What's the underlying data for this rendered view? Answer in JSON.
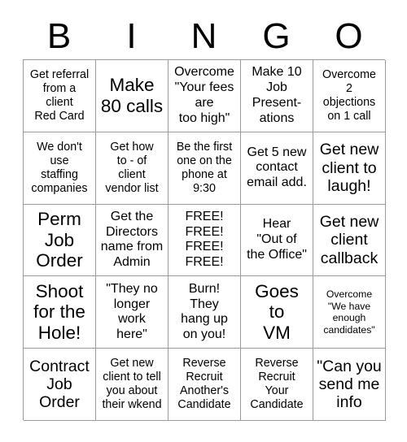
{
  "title": "BINGO",
  "header": {
    "letters": [
      "B",
      "I",
      "N",
      "G",
      "O"
    ]
  },
  "grid": {
    "columns": 5,
    "rows": 5,
    "cells": [
      {
        "text": "Get referral\nfrom a\nclient\nRed Card",
        "size": "sm"
      },
      {
        "text": "Make\n80 calls",
        "size": "xl"
      },
      {
        "text": "Overcome\n\"Your fees\nare\ntoo high\"",
        "size": "md"
      },
      {
        "text": "Make 10\nJob\nPresent-\nations",
        "size": "md"
      },
      {
        "text": "Overcome\n2\nobjections\non 1 call",
        "size": "sm"
      },
      {
        "text": "We don't\nuse\nstaffing\ncompanies",
        "size": "sm"
      },
      {
        "text": "Get how\nto - of\nclient\nvendor list",
        "size": "sm"
      },
      {
        "text": "Be the first\none on the\nphone at\n9:30",
        "size": "sm"
      },
      {
        "text": "Get 5 new\ncontact\nemail add.",
        "size": "md"
      },
      {
        "text": "Get new\nclient to\nlaugh!",
        "size": "lg"
      },
      {
        "text": "Perm\nJob\nOrder",
        "size": "xl"
      },
      {
        "text": "Get the\nDirectors\nname from\nAdmin",
        "size": "md"
      },
      {
        "text": "FREE!\nFREE!\nFREE!\nFREE!",
        "size": "md"
      },
      {
        "text": "Hear\n\"Out of\nthe Office\"",
        "size": "md"
      },
      {
        "text": "Get new\nclient\ncallback",
        "size": "lg"
      },
      {
        "text": "Shoot\nfor the\nHole!",
        "size": "xl"
      },
      {
        "text": "\"They no\nlonger\nwork\nhere\"",
        "size": "md"
      },
      {
        "text": "Burn!\nThey\nhang up\non you!",
        "size": "md"
      },
      {
        "text": "Goes\nto\nVM",
        "size": "xl"
      },
      {
        "text": "Overcome\n\"We have\nenough\ncandidates\"",
        "size": "xs"
      },
      {
        "text": "Contract\nJob\nOrder",
        "size": "lg"
      },
      {
        "text": "Get new\nclient to tell\nyou about\ntheir wkend",
        "size": "sm"
      },
      {
        "text": "Reverse\nRecruit\nAnother's\nCandidate",
        "size": "sm"
      },
      {
        "text": "Reverse\nRecruit\nYour\nCandidate",
        "size": "sm"
      },
      {
        "text": "\"Can you\nsend me\ninfo",
        "size": "lg"
      }
    ]
  },
  "colors": {
    "background": "#ffffff",
    "text": "#000000",
    "border": "#9a9a9a"
  }
}
